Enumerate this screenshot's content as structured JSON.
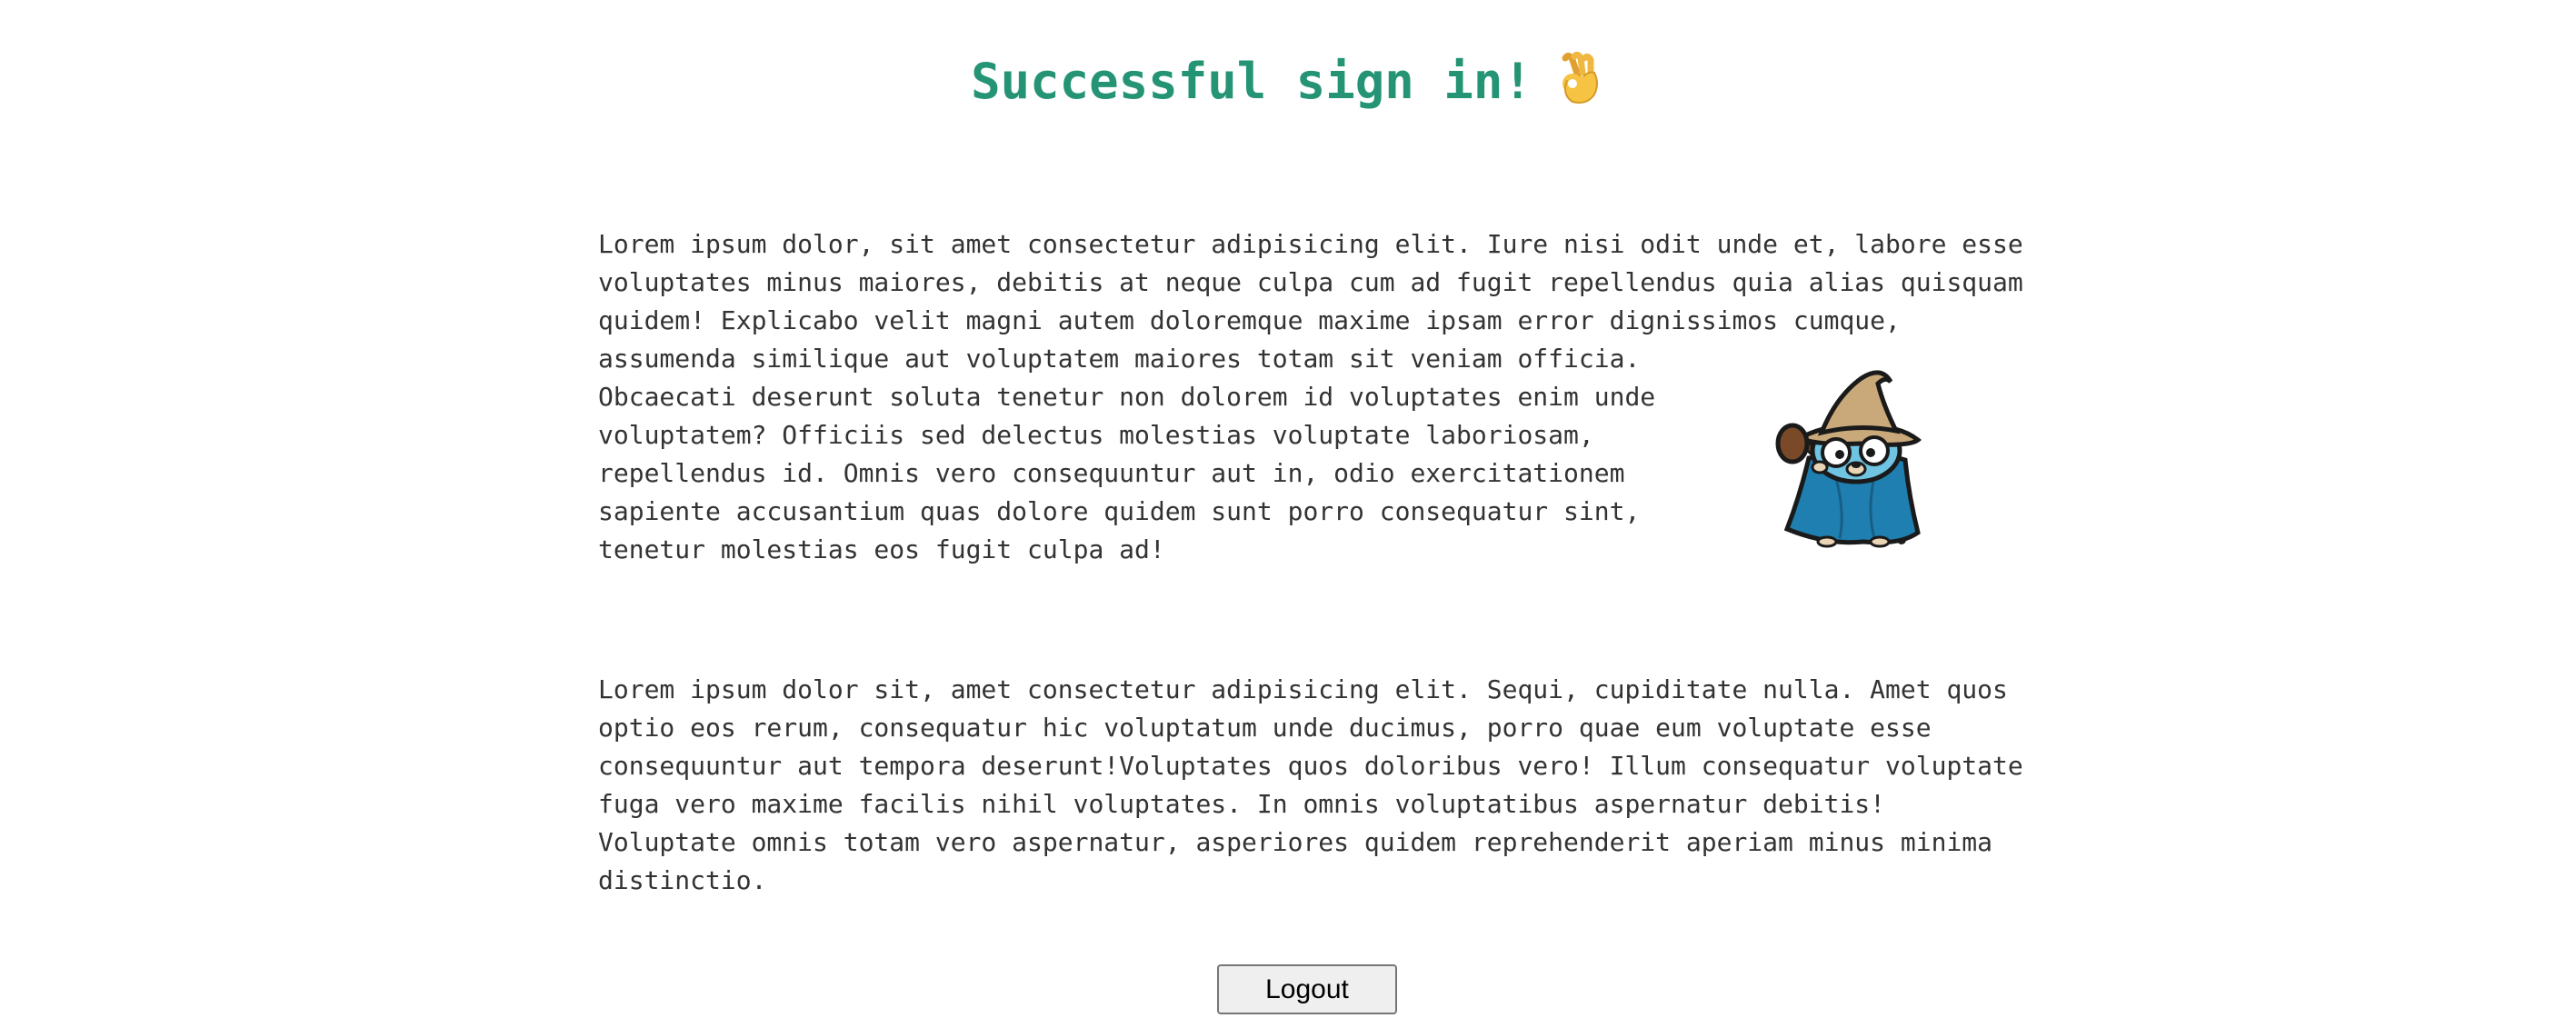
{
  "page": {
    "title": "Successful sign in!",
    "title_emoji": "ok-hand-icon",
    "title_color": "#249474",
    "text_color": "#333333"
  },
  "content": {
    "paragraph1": {
      "lines": [
        "Lorem ipsum dolor, sit amet consectetur adipisicing elit. Iure nisi odit unde et, labore esse",
        "voluptates minus maiores, debitis at neque culpa cum ad fugit repellendus quia alias quisquam",
        "quidem! Explicabo velit magni autem doloremque maxime ipsam error dignissimos cumque,",
        "assumenda similique aut voluptatem maiores totam sit veniam officia.",
        "Obcaecati deserunt soluta tenetur non dolorem id voluptates enim unde",
        "voluptatem? Officiis sed delectus molestias voluptate laboriosam,",
        "repellendus id. Omnis vero consequuntur aut in, odio exercitationem",
        "sapiente accusantium quas dolore quidem sunt porro consequatur sint,",
        "tenetur molestias eos fugit culpa ad!"
      ]
    },
    "image": {
      "icon": "gopher-wizard-icon"
    },
    "paragraph2": {
      "lines": [
        "Lorem ipsum dolor sit, amet consectetur adipisicing elit. Sequi, cupiditate nulla. Amet quos",
        "optio eos rerum, consequatur hic voluptatum unde ducimus, porro quae eum voluptate esse",
        "consequuntur aut tempora deserunt!Voluptates quos doloribus vero! Illum consequatur voluptate",
        "fuga vero maxime facilis nihil voluptates. In omnis voluptatibus aspernatur debitis!",
        "Voluptate omnis totam vero aspernatur, asperiores quidem reprehenderit aperiam minus minima",
        "distinctio."
      ]
    }
  },
  "actions": {
    "logout_label": "Logout"
  }
}
